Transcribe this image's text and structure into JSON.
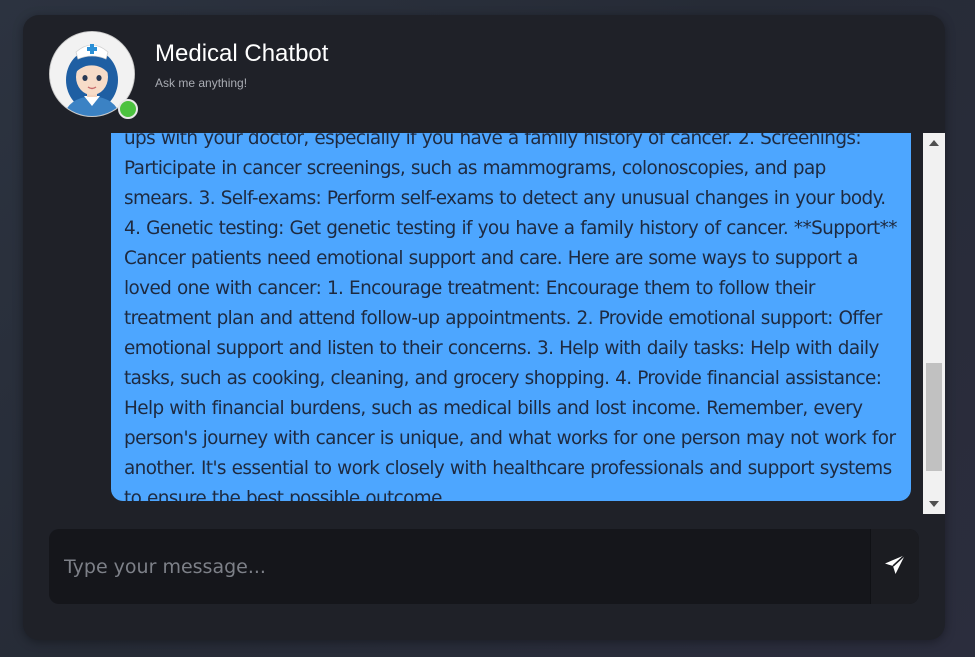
{
  "header": {
    "title": "Medical Chatbot",
    "subtitle": "Ask me anything!",
    "avatar_icon": "nurse-avatar-icon",
    "status": "online",
    "status_color": "#4cc23f"
  },
  "messages": [
    {
      "role": "bot",
      "text": "ups with your doctor, especially if you have a family history of cancer. 2. Screenings: Participate in cancer screenings, such as mammograms, colonoscopies, and pap smears. 3. Self-exams: Perform self-exams to detect any unusual changes in your body. 4. Genetic testing: Get genetic testing if you have a family history of cancer. **Support** Cancer patients need emotional support and care. Here are some ways to support a loved one with cancer: 1. Encourage treatment: Encourage them to follow their treatment plan and attend follow-up appointments. 2. Provide emotional support: Offer emotional support and listen to their concerns. 3. Help with daily tasks: Help with daily tasks, such as cooking, cleaning, and grocery shopping. 4. Provide financial assistance: Help with financial burdens, such as medical bills and lost income. Remember, every person's journey with cancer is unique, and what works for one person may not work for another. It's essential to work closely with healthcare professionals and support systems to ensure the best possible outcome.",
      "bubble_color": "#4da6ff"
    }
  ],
  "composer": {
    "placeholder": "Type your message...",
    "value": "",
    "send_icon": "send-icon"
  },
  "colors": {
    "card_background": "#1f2128",
    "page_background": "#2a2f3b"
  }
}
